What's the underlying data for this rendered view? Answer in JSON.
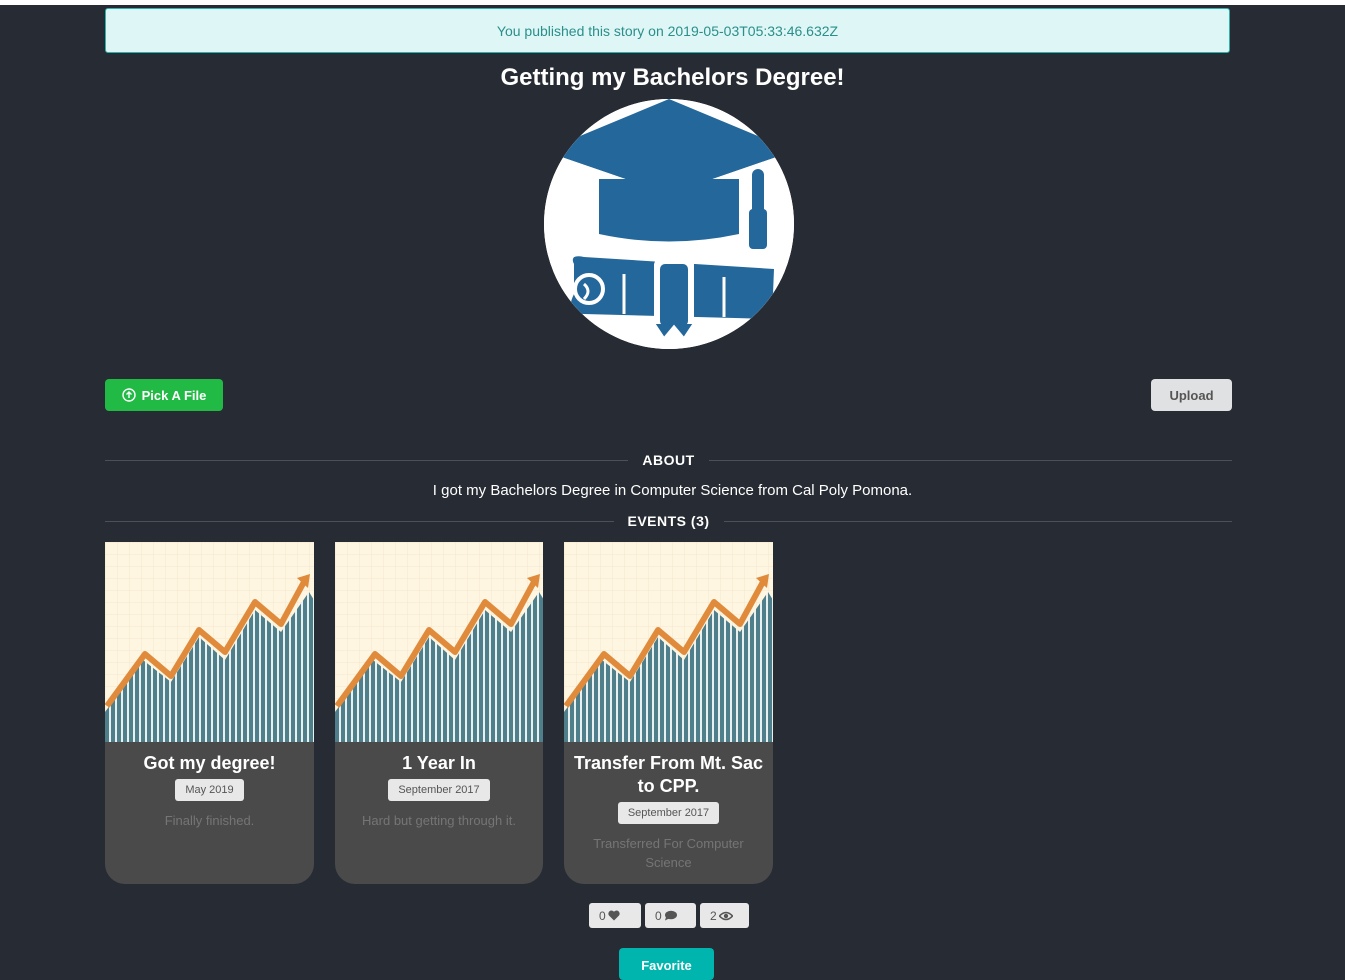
{
  "notice": {
    "text": "You published this story on 2019-05-03T05:33:46.632Z"
  },
  "story": {
    "title": "Getting my Bachelors Degree!",
    "image_icon": "graduation-cap-diploma"
  },
  "actions": {
    "pick_file_label": "Pick A File",
    "upload_label": "Upload"
  },
  "about": {
    "heading": "ABOUT",
    "text": "I got my Bachelors Degree in Computer Science from Cal Poly Pomona."
  },
  "events": {
    "heading": "EVENTS (3)",
    "items": [
      {
        "title": "Got my degree!",
        "date": "May 2019",
        "description": "Finally finished."
      },
      {
        "title": "1 Year In",
        "date": "September 2017",
        "description": "Hard but getting through it."
      },
      {
        "title": "Transfer From Mt. Sac to CPP.",
        "date": "September 2017",
        "description": "Transferred For Computer Science"
      }
    ]
  },
  "stats": {
    "likes": "0",
    "comments": "0",
    "views": "2"
  },
  "favorite_label": "Favorite",
  "colors": {
    "background": "#272b33",
    "notice_bg": "#dff6f6",
    "notice_text": "#2a8f8a",
    "green": "#21ba45",
    "teal": "#00b5ad",
    "card_bg": "#4a4a4a",
    "brand_blue": "#24679a"
  }
}
